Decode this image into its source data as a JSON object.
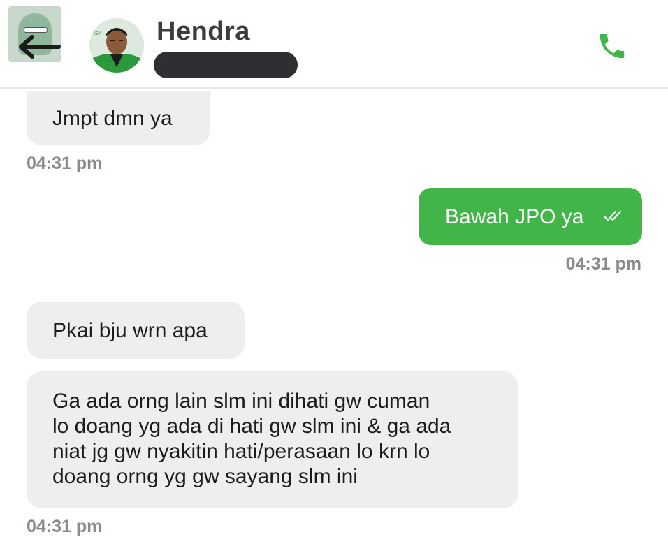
{
  "header": {
    "contact_name": "Hendra",
    "phone_number_redacted": true,
    "call_icon": "phone-icon",
    "back_icon": "back-arrow-icon"
  },
  "colors": {
    "accent": "#42b549",
    "incoming_bubble": "#eeeeee",
    "outgoing_bubble": "#42b549",
    "timestamp": "#8a8a8a",
    "redaction": "#2d2f32"
  },
  "messages": [
    {
      "direction": "incoming",
      "text": "Jmpt dmn ya",
      "time": "04:31 pm"
    },
    {
      "direction": "outgoing",
      "text": "Bawah JPO ya",
      "time": "04:31 pm",
      "status_icon": "double-check-icon"
    },
    {
      "direction": "incoming",
      "text": "Pkai bju wrn apa"
    },
    {
      "direction": "incoming",
      "lines": [
        "Ga ada orng lain slm ini dihati gw cuman",
        "lo doang yg ada di hati gw slm ini & ga ada",
        "niat jg gw nyakitin hati/perasaan lo krn lo",
        "doang orng yg gw sayang slm ini"
      ],
      "time": "04:31 pm"
    }
  ]
}
